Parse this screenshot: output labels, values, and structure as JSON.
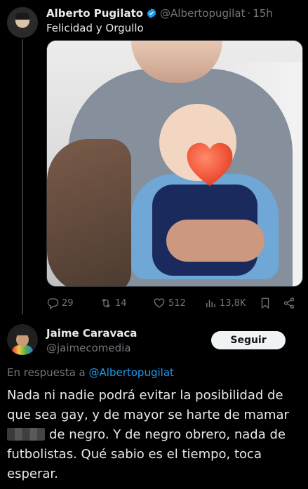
{
  "tweet": {
    "author_name": "Alberto Pugilato",
    "handle": "@Albertopugilat",
    "separator": "·",
    "time": "15h",
    "text": "Felicidad y Orgullo",
    "media_icon": "photo-baby-heart",
    "stats": {
      "replies": "29",
      "retweets": "14",
      "likes": "512",
      "views": "13,8K"
    },
    "colors": {
      "verified": "#1d9bf0",
      "background": "#000000",
      "muted": "#71767b"
    }
  },
  "reply": {
    "author_name": "Jaime Caravaca",
    "handle": "@jaimecomedia",
    "follow_label": "Seguir",
    "in_reply_prefix": "En respuesta a",
    "in_reply_mention": "@Albertopugilat",
    "text_part1": "Nada ni nadie podrá evitar la posibilidad de que sea gay, y de mayor se harte de mamar",
    "text_part2": "de negro. Y de negro obrero, nada de futbolistas. Qué sabio es el tiempo, toca esperar.",
    "colors": {
      "mention": "#1d9bf0"
    }
  }
}
